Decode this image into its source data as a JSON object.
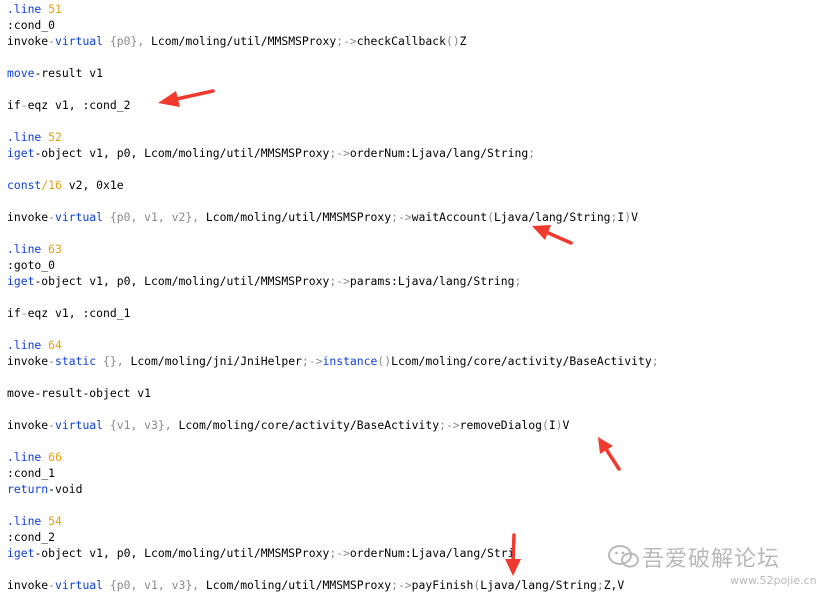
{
  "colors": {
    "blue": "#0e3fd8",
    "orange": "#e3a012",
    "gray": "#8a8a8a",
    "black": "#000000",
    "arrow": "#f03a2e",
    "watermark": "#b9b9b9"
  },
  "code_lines": [
    [
      {
        "t": ".line ",
        "c": "blue"
      },
      {
        "t": "51",
        "c": "orange"
      }
    ],
    [
      {
        "t": ":cond_0",
        "c": "black"
      }
    ],
    [
      {
        "t": "invoke",
        "c": "black"
      },
      {
        "t": "-",
        "c": "gray"
      },
      {
        "t": "virtual",
        "c": "blue"
      },
      {
        "t": " {p0}, ",
        "c": "gray"
      },
      {
        "t": "Lcom/moling/util/MMSMSProxy",
        "c": "black"
      },
      {
        "t": ";->",
        "c": "gray"
      },
      {
        "t": "checkCallback",
        "c": "black"
      },
      {
        "t": "()",
        "c": "gray"
      },
      {
        "t": "Z",
        "c": "black"
      }
    ],
    [],
    [
      {
        "t": "move",
        "c": "blue"
      },
      {
        "t": "-result v1",
        "c": "black"
      }
    ],
    [],
    [
      {
        "t": "if",
        "c": "black"
      },
      {
        "t": "-",
        "c": "gray"
      },
      {
        "t": "eqz v1, :cond_2",
        "c": "black"
      }
    ],
    [],
    [
      {
        "t": ".line ",
        "c": "blue"
      },
      {
        "t": "52",
        "c": "orange"
      }
    ],
    [
      {
        "t": "iget",
        "c": "blue"
      },
      {
        "t": "-object v1, p0, Lcom/moling/util/MMSMSProxy",
        "c": "black"
      },
      {
        "t": ";->",
        "c": "gray"
      },
      {
        "t": "orderNum:Ljava/lang/String",
        "c": "black"
      },
      {
        "t": ";",
        "c": "gray"
      }
    ],
    [],
    [
      {
        "t": "const",
        "c": "blue"
      },
      {
        "t": "/16",
        "c": "orange"
      },
      {
        "t": " v2, ",
        "c": "black"
      },
      {
        "t": "0x1e",
        "c": "black"
      }
    ],
    [],
    [
      {
        "t": "invoke",
        "c": "black"
      },
      {
        "t": "-",
        "c": "gray"
      },
      {
        "t": "virtual",
        "c": "blue"
      },
      {
        "t": " {p0, v1, v2}, ",
        "c": "gray"
      },
      {
        "t": "Lcom/moling/util/MMSMSProxy",
        "c": "black"
      },
      {
        "t": ";->",
        "c": "gray"
      },
      {
        "t": "waitAccount",
        "c": "black"
      },
      {
        "t": "(",
        "c": "gray"
      },
      {
        "t": "Ljava/lang/String",
        "c": "black"
      },
      {
        "t": ";",
        "c": "gray"
      },
      {
        "t": "I",
        "c": "black"
      },
      {
        "t": ")",
        "c": "gray"
      },
      {
        "t": "V",
        "c": "black"
      }
    ],
    [],
    [
      {
        "t": ".line ",
        "c": "blue"
      },
      {
        "t": "63",
        "c": "orange"
      }
    ],
    [
      {
        "t": ":goto_0",
        "c": "black"
      }
    ],
    [
      {
        "t": "iget",
        "c": "blue"
      },
      {
        "t": "-object v1, p0, Lcom/moling/util/MMSMSProxy",
        "c": "black"
      },
      {
        "t": ";->",
        "c": "gray"
      },
      {
        "t": "params:Ljava/lang/String",
        "c": "black"
      },
      {
        "t": ";",
        "c": "gray"
      }
    ],
    [],
    [
      {
        "t": "if",
        "c": "black"
      },
      {
        "t": "-",
        "c": "gray"
      },
      {
        "t": "eqz v1, :cond_1",
        "c": "black"
      }
    ],
    [],
    [
      {
        "t": ".line ",
        "c": "blue"
      },
      {
        "t": "64",
        "c": "orange"
      }
    ],
    [
      {
        "t": "invoke",
        "c": "black"
      },
      {
        "t": "-",
        "c": "gray"
      },
      {
        "t": "static",
        "c": "blue"
      },
      {
        "t": " {}, ",
        "c": "gray"
      },
      {
        "t": "Lcom/moling/jni/JniHelper",
        "c": "black"
      },
      {
        "t": ";->",
        "c": "gray"
      },
      {
        "t": "instance",
        "c": "blue"
      },
      {
        "t": "()",
        "c": "gray"
      },
      {
        "t": "Lcom/moling/core/activity/BaseActivity",
        "c": "black"
      },
      {
        "t": ";",
        "c": "gray"
      }
    ],
    [],
    [
      {
        "t": "move",
        "c": "black"
      },
      {
        "t": "-result-object v1",
        "c": "black"
      }
    ],
    [],
    [
      {
        "t": "invoke",
        "c": "black"
      },
      {
        "t": "-",
        "c": "gray"
      },
      {
        "t": "virtual",
        "c": "blue"
      },
      {
        "t": " {v1, v3}, ",
        "c": "gray"
      },
      {
        "t": "Lcom/moling/core/activity/BaseActivity",
        "c": "black"
      },
      {
        "t": ";->",
        "c": "gray"
      },
      {
        "t": "removeDialog",
        "c": "black"
      },
      {
        "t": "(",
        "c": "gray"
      },
      {
        "t": "I",
        "c": "black"
      },
      {
        "t": ")",
        "c": "gray"
      },
      {
        "t": "V",
        "c": "black"
      }
    ],
    [],
    [
      {
        "t": ".line ",
        "c": "blue"
      },
      {
        "t": "66",
        "c": "orange"
      }
    ],
    [
      {
        "t": ":cond_1",
        "c": "black"
      }
    ],
    [
      {
        "t": "return",
        "c": "blue"
      },
      {
        "t": "-void",
        "c": "black"
      }
    ],
    [],
    [
      {
        "t": ".line ",
        "c": "blue"
      },
      {
        "t": "54",
        "c": "orange"
      }
    ],
    [
      {
        "t": ":cond_2",
        "c": "black"
      }
    ],
    [
      {
        "t": "iget",
        "c": "blue"
      },
      {
        "t": "-object v1, p0, Lcom/moling/util/MMSMSProxy",
        "c": "black"
      },
      {
        "t": ";->",
        "c": "gray"
      },
      {
        "t": "orderNum:Ljava/lang/Stri",
        "c": "black"
      }
    ],
    [],
    [
      {
        "t": "invoke",
        "c": "black"
      },
      {
        "t": "-",
        "c": "gray"
      },
      {
        "t": "virtual",
        "c": "blue"
      },
      {
        "t": " {p0, v1, v3}, ",
        "c": "gray"
      },
      {
        "t": "Lcom/moling/util/MMSMSProxy",
        "c": "black"
      },
      {
        "t": ";->",
        "c": "gray"
      },
      {
        "t": "payFinish",
        "c": "black"
      },
      {
        "t": "(",
        "c": "gray"
      },
      {
        "t": "Ljava/lang/String",
        "c": "black"
      },
      {
        "t": ";",
        "c": "gray"
      },
      {
        "t": "Z,V",
        "c": "black"
      }
    ]
  ],
  "annotations": [
    {
      "name": "arrow-cond-2",
      "icon": "red-arrow-icon",
      "points_to": "if-eqz v1, :cond_2"
    },
    {
      "name": "arrow-wait-account",
      "icon": "red-arrow-icon",
      "points_to": "waitAccount"
    },
    {
      "name": "arrow-remove-dialog",
      "icon": "red-arrow-icon",
      "points_to": "removeDialog"
    },
    {
      "name": "arrow-pay-finish",
      "icon": "red-arrow-icon",
      "points_to": "payFinish"
    }
  ],
  "watermark": {
    "icon": "wechat-logo-icon",
    "name": "吾爱破解论坛",
    "url": "www.52pojie.cn"
  }
}
